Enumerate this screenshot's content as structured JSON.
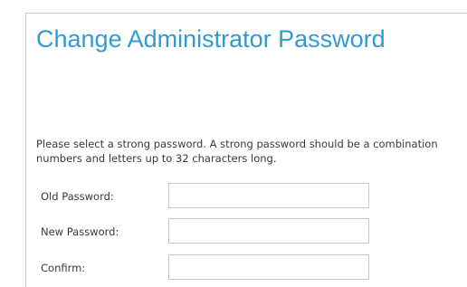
{
  "page": {
    "title": "Change Administrator Password",
    "description_line1": "Please select a strong password. A strong password should be a combination",
    "description_line2": "numbers and letters up to 32 characters long."
  },
  "form": {
    "old_password": {
      "label": "Old Password:",
      "value": ""
    },
    "new_password": {
      "label": "New Password:",
      "value": ""
    },
    "confirm": {
      "label": "Confirm:",
      "value": ""
    }
  },
  "colors": {
    "title": "#2f9bd2",
    "text": "#3a3a3a",
    "border": "#c8c8c8"
  }
}
